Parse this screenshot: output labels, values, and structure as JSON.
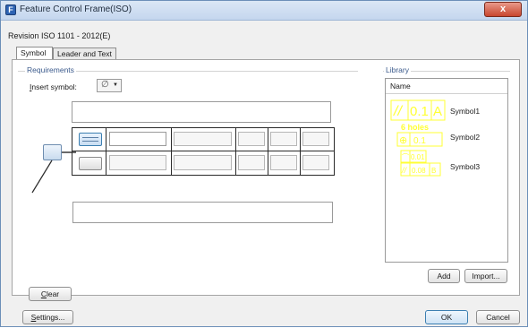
{
  "window": {
    "title": "Feature Control Frame(ISO)",
    "close_glyph": "x"
  },
  "standard_label": "Revision ISO 1101 - 2012(E)",
  "tabs": [
    {
      "label": "Symbol",
      "active": true
    },
    {
      "label": "Leader and Text",
      "active": false
    }
  ],
  "requirements": {
    "group_label": "Requirements",
    "insert_symbol_label": "Insert symbol:",
    "insert_symbol_value": "∅",
    "above_text": "",
    "below_text": ""
  },
  "frame": {
    "rows": [
      {
        "tolerance": "",
        "datum1": "",
        "datum2": "",
        "datum3": "",
        "datum4": "",
        "datum5": ""
      },
      {
        "tolerance": "",
        "datum1": "",
        "datum2": "",
        "datum3": "",
        "datum4": "",
        "datum5": ""
      }
    ]
  },
  "library": {
    "group_label": "Library",
    "column_header": "Name",
    "thumbnail_color": "#ffff33",
    "items": [
      {
        "name": "Symbol1",
        "thumb_lines": [
          "//",
          "0.1",
          "A"
        ]
      },
      {
        "name": "Symbol2",
        "thumb_lines": [
          "6 holes",
          "⊕",
          "0.1"
        ]
      },
      {
        "name": "Symbol3",
        "thumb_lines": [
          "⌒",
          "0.01",
          "//",
          "0.08",
          "B"
        ]
      }
    ],
    "add_label": "Add",
    "import_label": "Import..."
  },
  "buttons": {
    "clear_label": "Clear",
    "settings_label": "Settings...",
    "ok_label": "OK",
    "cancel_label": "Cancel"
  }
}
